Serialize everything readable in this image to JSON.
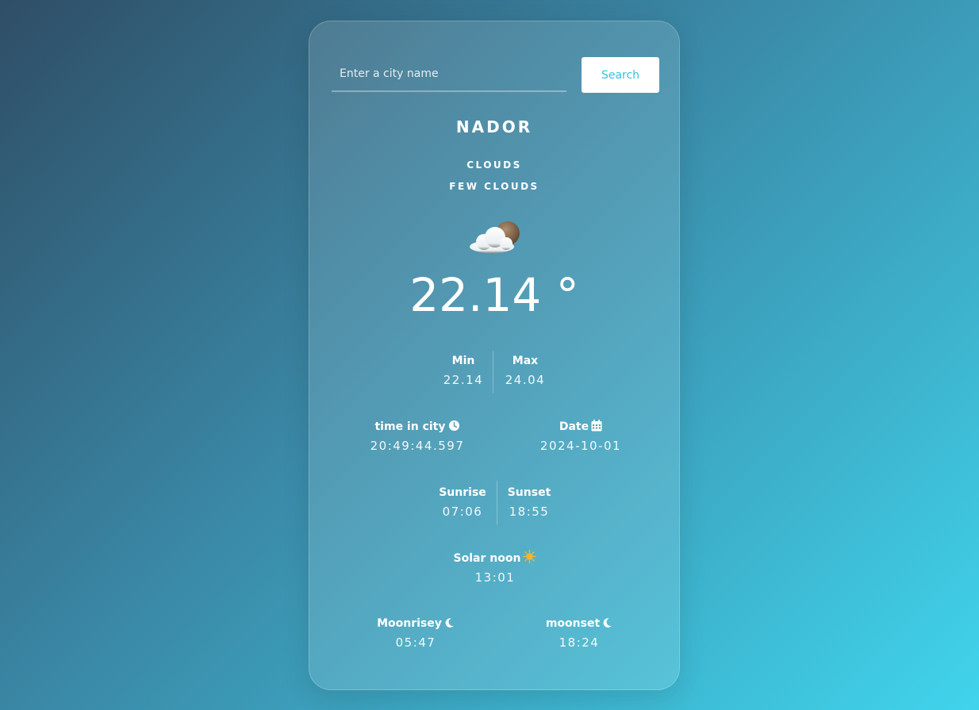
{
  "search": {
    "placeholder": "Enter a city name",
    "value": "",
    "button_label": "Search"
  },
  "weather": {
    "city": "NADOR",
    "main": "CLOUDS",
    "description": "FEW CLOUDS",
    "icon": "few-clouds-night-icon",
    "temperature": "22.14 °"
  },
  "min_max": {
    "min_label": "Min",
    "min_value": "22.14",
    "max_label": "Max",
    "max_value": "24.04"
  },
  "time_date": {
    "time_label": "time in city",
    "time_value": "20:49:44.597",
    "time_icon": "clock-icon",
    "date_label": "Date",
    "date_value": "2024-10-01",
    "date_icon": "calendar-icon"
  },
  "sun": {
    "sunrise_label": "Sunrise",
    "sunrise_value": "07:06",
    "sunset_label": "Sunset",
    "sunset_value": "18:55",
    "solar_noon_label": "Solar noon",
    "solar_noon_value": "13:01",
    "solar_noon_icon": "sun-icon"
  },
  "moon": {
    "moonrise_label": "Moonrisey",
    "moonrise_value": "05:47",
    "moonset_label": "moonset",
    "moonset_value": "18:24",
    "moon_icon": "moon-icon"
  },
  "colors": {
    "accent": "#35c2dc",
    "background_start": "#2f4e66",
    "background_end": "#40d4ec",
    "sun": "#f3b62a"
  }
}
